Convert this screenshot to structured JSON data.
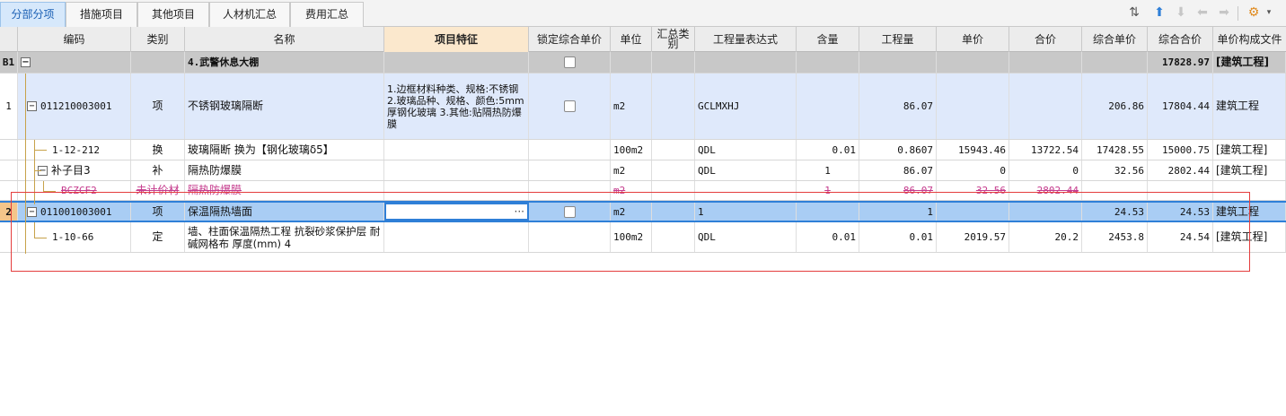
{
  "tabs": [
    {
      "label": "分部分项"
    },
    {
      "label": "措施项目"
    },
    {
      "label": "其他项目"
    },
    {
      "label": "人材机汇总"
    },
    {
      "label": "费用汇总"
    }
  ],
  "headers": {
    "code": "编码",
    "type": "类别",
    "name": "名称",
    "feature": "项目特征",
    "lock": "锁定综合单价",
    "unit": "单位",
    "sumtype": "汇总类别",
    "expr": "工程量表达式",
    "content": "含量",
    "qty": "工程量",
    "price": "单价",
    "total": "合价",
    "cprice": "综合单价",
    "ctotal": "综合合价",
    "file": "单价构成文件"
  },
  "rows": {
    "b1": {
      "num": "B1",
      "name": "4.武警休息大棚",
      "ctotal": "17828.97",
      "file": "[建筑工程]"
    },
    "r1": {
      "num": "1",
      "code": "011210003001",
      "type": "项",
      "name": "不锈钢玻璃隔断",
      "feature": "1.边框材料种类、规格:不锈钢 2.玻璃品种、规格、颜色:5mm厚钢化玻璃 3.其他:贴隔热防爆膜",
      "unit": "m2",
      "expr": "GCLMXHJ",
      "qty": "86.07",
      "cprice": "206.86",
      "ctotal": "17804.44",
      "file": "建筑工程"
    },
    "r1a": {
      "code": "1-12-212",
      "type": "换",
      "name": "玻璃隔断  换为【钢化玻璃δ5】",
      "unit": "100m2",
      "expr": "QDL",
      "content": "0.01",
      "qty": "0.8607",
      "price": "15943.46",
      "total": "13722.54",
      "cprice": "17428.55",
      "ctotal": "15000.75",
      "file": "[建筑工程]"
    },
    "r1b": {
      "code": "补子目3",
      "type": "补",
      "name": "隔热防爆膜",
      "unit": "m2",
      "expr": "QDL",
      "content": "1",
      "qty": "86.07",
      "price": "0",
      "total": "0",
      "cprice": "32.56",
      "ctotal": "2802.44",
      "file": "[建筑工程]"
    },
    "r1c": {
      "code": "BCZCF2",
      "type": "未计价材",
      "name": "隔热防爆膜",
      "unit": "m2",
      "content": "1",
      "qty": "86.07",
      "price": "32.56",
      "total": "2802.44"
    },
    "r2": {
      "num": "2",
      "code": "011001003001",
      "type": "项",
      "name": "保温隔热墙面",
      "feature_btn": "···",
      "unit": "m2",
      "expr": "1",
      "qty": "1",
      "cprice": "24.53",
      "ctotal": "24.53",
      "file": "建筑工程"
    },
    "r2a": {
      "code": "1-10-66",
      "type": "定",
      "name": "墙、柱面保温隔热工程 抗裂砂浆保护层 耐碱网格布 厚度(mm) 4",
      "unit": "100m2",
      "expr": "QDL",
      "content": "0.01",
      "qty": "0.01",
      "price": "2019.57",
      "total": "20.2",
      "cprice": "2453.8",
      "ctotal": "24.54",
      "file": "[建筑工程]"
    }
  },
  "colors": {
    "accent": "#2f7fd7",
    "highlight": "#e43d3d",
    "feature_header": "#fbe8cd",
    "unpriced_text": "#c53b8d"
  }
}
